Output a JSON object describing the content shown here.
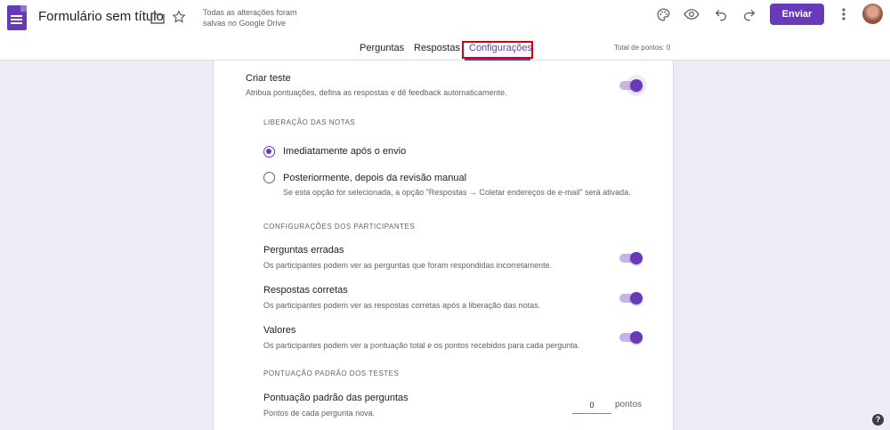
{
  "header": {
    "doc_title": "Formulário sem título",
    "save_status": "Todas as alterações foram salvas no Google Drive",
    "send_label": "Enviar"
  },
  "tabs": [
    {
      "label": "Perguntas"
    },
    {
      "label": "Respostas"
    },
    {
      "label": "Configurações",
      "active": true
    }
  ],
  "total_points": "Total de pontos: 0",
  "quiz": {
    "title": "Criar teste",
    "description": "Atribua pontuações, defina as respostas e dê feedback automaticamente.",
    "enabled": true
  },
  "release": {
    "heading": "LIBERAÇÃO DAS NOTAS",
    "options": [
      {
        "label": "Imediatamente após o envio",
        "selected": true
      },
      {
        "label": "Posteriormente, depois da revisão manual",
        "selected": false,
        "note": "Se esta opção for selecionada, a opção \"Respostas → Coletar endereços de e-mail\" será ativada."
      }
    ]
  },
  "participants": {
    "heading": "CONFIGURAÇÕES DOS PARTICIPANTES",
    "settings": [
      {
        "title": "Perguntas erradas",
        "description": "Os participantes podem ver as perguntas que foram respondidas incorretamente.",
        "enabled": true
      },
      {
        "title": "Respostas corretas",
        "description": "Os participantes podem ver as respostas corretas após a liberação das notas.",
        "enabled": true
      },
      {
        "title": "Valores",
        "description": "Os participantes podem ver a pontuação total e os pontos recebidos para cada pergunta.",
        "enabled": true
      }
    ]
  },
  "defaults": {
    "heading": "PONTUAÇÃO PADRÃO DOS TESTES",
    "title": "Pontuação padrão das perguntas",
    "description": "Pontos de cada pergunta nova.",
    "value": "0",
    "unit": "pontos"
  },
  "help_label": "?",
  "colors": {
    "accent": "#673ab7",
    "highlight": "#d3000f",
    "background": "#efebf6"
  }
}
